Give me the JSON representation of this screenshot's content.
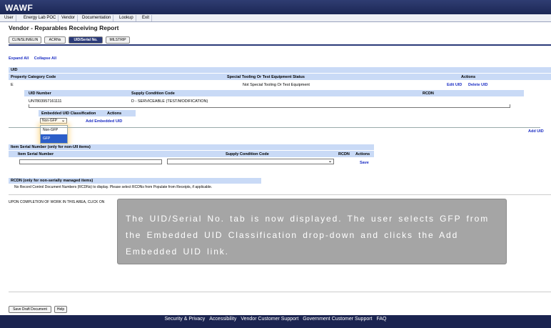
{
  "app": {
    "title": "WAWF"
  },
  "menu": {
    "user": "User",
    "energy": "Energy Lab POC",
    "vendor": "Vendor",
    "documentation": "Documentation",
    "lookup": "Lookup",
    "exit": "Exit"
  },
  "page": {
    "title": "Vendor - Reparables Receiving Report"
  },
  "tabs": {
    "clin": "CLIN/SLIN/ELIN",
    "acrns": "ACRNs",
    "uid": "UID/Serial No.",
    "milstrip": "MILSTRIP"
  },
  "expand_links": {
    "expand_all": "Expand All",
    "collapse_all": "Collapse All"
  },
  "uid_section": {
    "header": "UID",
    "columns": {
      "property": "Property Category Code",
      "special": "Special Tooling Or Test Equipment Status",
      "actions": "Actions"
    },
    "row": {
      "property": "E",
      "special": "Not Special Tooling Or Test Equipment",
      "edit": "Edit UID",
      "delete": "Delete UID"
    },
    "sub_columns": {
      "uid_number": "UID Number",
      "supply": "Supply Condition Code",
      "rcdn": "RCDN"
    },
    "sub_row": {
      "uid_number": "UN7803957161111",
      "supply": "D - SERVICEABLE (TEST/MODIFICATION)"
    },
    "embedded": {
      "col_class": "Embedded UID Classification",
      "col_actions": "Actions",
      "select_value": "Non-GFP",
      "options": [
        "Non-GFP",
        "GFP"
      ],
      "add_link": "Add Embedded UID"
    },
    "add_uid": "Add UID"
  },
  "item_serial": {
    "header": "Item Serial Number (only for non-UII items)",
    "columns": {
      "serial": "Item Serial Number",
      "supply": "Supply Condition Code",
      "rcdn": "RCDN",
      "actions": "Actions"
    },
    "save": "Save"
  },
  "rcdn": {
    "header": "RCDN (only for non-serially managed items)",
    "message": "No Record Control Document Numbers (RCDNs) to display. Please select RCDNs from Populate from Receipts, if applicable."
  },
  "completion_text": "UPON COMPLETION OF WORK IN THIS AREA, CLICK ON",
  "overlay": {
    "message": "The UID/Serial No. tab is now displayed. The user selects GFP from the Embedded UID Classification drop-down and clicks the Add Embedded UID link."
  },
  "buttons": {
    "save_draft": "Save Draft Document",
    "help": "Help"
  },
  "footer": {
    "security": "Security & Privacy",
    "accessibility": "Accessibility",
    "vendor_support": "Vendor Customer Support",
    "gov_support": "Government Customer Support",
    "faq": "FAQ"
  }
}
